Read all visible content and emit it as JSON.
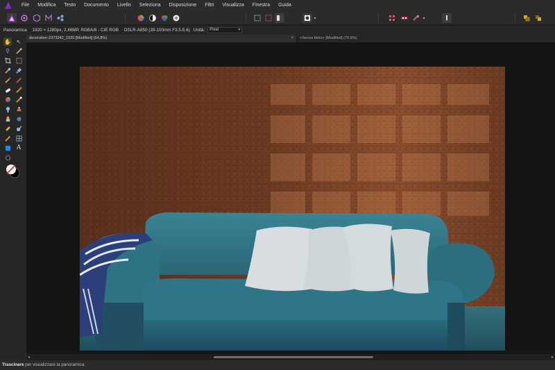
{
  "menu": [
    "File",
    "Modifica",
    "Testo",
    "Documento",
    "Livello",
    "Seleziona",
    "Disposizione",
    "Filtri",
    "Visualizza",
    "Finestra",
    "Guida"
  ],
  "context": {
    "tool_name": "Panoramica",
    "info": "1920 × 1280px, 2,46MP, RGBA/8 - CIE RGB",
    "lens": "DSLR-A850 (28-100mm F3.5-5.6)",
    "units_label": "Unità:",
    "units_value": "Pixel"
  },
  "tabs": [
    {
      "label": "decoration-2373342_1920 [Modified] (64,8%)",
      "close": "×"
    },
    {
      "label": "<Senza titolo> [Modified] (76,9%)"
    }
  ],
  "status": {
    "bold": "Trascinare",
    "rest": " per visualizzare la panoramica."
  },
  "colors": {
    "accent": "#a53cd8",
    "wall": "#6b3a22",
    "sofa": "#2f7284",
    "pillow": "#d7dde0"
  },
  "icons": {
    "hand": "✋",
    "move": "↖",
    "zoom": "🔍",
    "crop": "⌗",
    "text": "A"
  }
}
